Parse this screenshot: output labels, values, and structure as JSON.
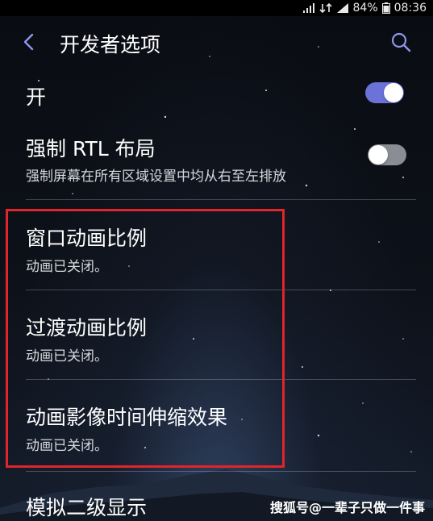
{
  "status_bar": {
    "battery": "84%",
    "time": "08:36"
  },
  "header": {
    "title": "开发者选项"
  },
  "master_switch": {
    "label": "开",
    "state": "on"
  },
  "settings": [
    {
      "title": "强制 RTL 布局",
      "subtitle": "强制屏幕在所有区域设置中均从右至左排放",
      "toggle": "off"
    },
    {
      "title": "窗口动画比例",
      "subtitle": "动画已关闭。"
    },
    {
      "title": "过渡动画比例",
      "subtitle": "动画已关闭。"
    },
    {
      "title": "动画影像时间伸缩效果",
      "subtitle": "动画已关闭。"
    },
    {
      "title": "模拟二级显示"
    }
  ],
  "watermark": "搜狐号@一辈子只做一件事",
  "colors": {
    "toggle_on": "#6b73d9",
    "toggle_off": "#8a8d93",
    "highlight": "#e2242b"
  }
}
